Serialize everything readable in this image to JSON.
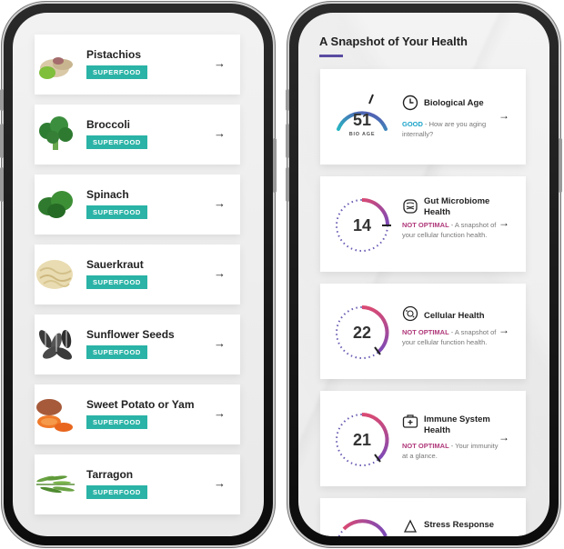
{
  "left_screen": {
    "foods": [
      {
        "name": "Pistachios",
        "tag": "SUPERFOOD",
        "icon": "pistachio-image"
      },
      {
        "name": "Broccoli",
        "tag": "SUPERFOOD",
        "icon": "broccoli-image"
      },
      {
        "name": "Spinach",
        "tag": "SUPERFOOD",
        "icon": "spinach-image"
      },
      {
        "name": "Sauerkraut",
        "tag": "SUPERFOOD",
        "icon": "sauerkraut-image"
      },
      {
        "name": "Sunflower Seeds",
        "tag": "SUPERFOOD",
        "icon": "sunflower-seeds-image"
      },
      {
        "name": "Sweet Potato or Yam",
        "tag": "SUPERFOOD",
        "icon": "sweet-potato-image"
      },
      {
        "name": "Tarragon",
        "tag": "SUPERFOOD",
        "icon": "tarragon-image"
      }
    ],
    "arrow": "→"
  },
  "right_screen": {
    "title": "A Snapshot of Your Health",
    "cards": [
      {
        "value": "51",
        "sublabel": "BIO AGE",
        "name": "Biological Age",
        "status": "GOOD",
        "description": " - How are you aging internally?",
        "icon": "clock-icon",
        "status_color": "#1aa3c9"
      },
      {
        "value": "14",
        "name": "Gut Microbiome Health",
        "status": "NOT OPTIMAL",
        "description": " - A snapshot of your cellular function health.",
        "icon": "gut-icon",
        "status_color": "#b0397a"
      },
      {
        "value": "22",
        "name": "Cellular Health",
        "status": "NOT OPTIMAL",
        "description": " - A snapshot of your cellular function health.",
        "icon": "cell-icon",
        "status_color": "#b0397a"
      },
      {
        "value": "21",
        "name": "Immune System Health",
        "status": "NOT OPTIMAL",
        "description": " - Your immunity at a glance.",
        "icon": "medkit-icon",
        "status_color": "#b0397a"
      },
      {
        "value": "",
        "name": "Stress Response",
        "status": "",
        "description": "",
        "icon": "stress-icon",
        "status_color": "#b0397a"
      }
    ],
    "arrow": "→"
  },
  "colors": {
    "tag": "#2ab3a6",
    "title_underline": "#5b4ba1",
    "ring_gradient_start": "#27b6c2",
    "ring_gradient_end": "#5a4fb0",
    "ring_warning_start": "#d94a73",
    "ring_warning_end": "#7c4ab7"
  }
}
